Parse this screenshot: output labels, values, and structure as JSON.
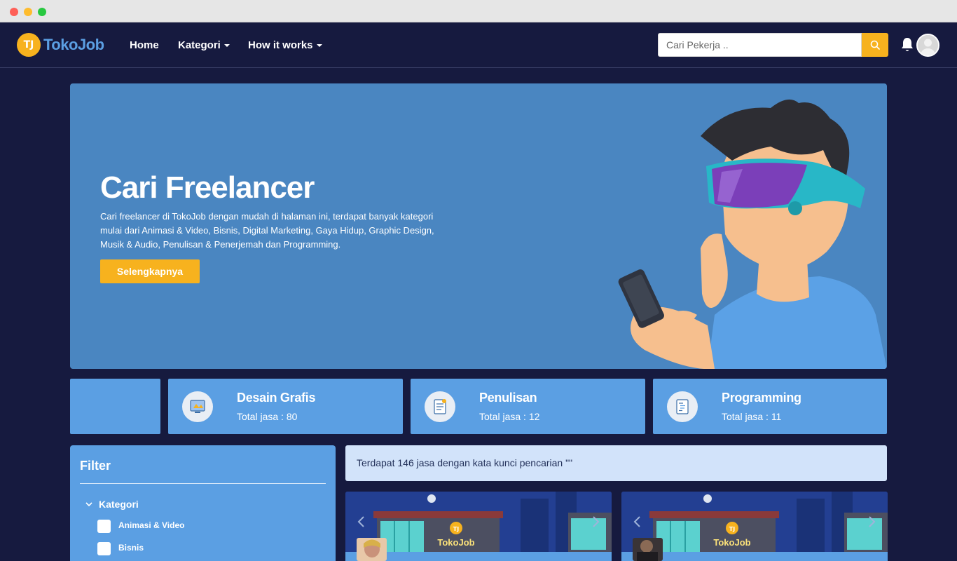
{
  "nav": {
    "brand": "TokoJob",
    "logo_mark": "TJ",
    "links": [
      {
        "label": "Home"
      },
      {
        "label": "Kategori"
      },
      {
        "label": "How it works"
      }
    ],
    "search_placeholder": "Cari Pekerja ..",
    "icons": [
      "search-icon",
      "bell-icon",
      "user-avatar"
    ]
  },
  "hero": {
    "title": "Cari Freelancer",
    "description": "Cari freelancer di TokoJob dengan mudah di halaman ini, terdapat banyak kategori mulai dari Animasi & Video, Bisnis, Digital Marketing, Gaya Hidup, Graphic Design, Musik & Audio, Penulisan & Penerjemah dan Programming.",
    "button": "Selengkapnya"
  },
  "categories": [
    {
      "name": "Desain Grafis",
      "total": "Total jasa : 80",
      "icon": "design-icon"
    },
    {
      "name": "Penulisan",
      "total": "Total jasa : 12",
      "icon": "writing-icon"
    },
    {
      "name": "Programming",
      "total": "Total jasa : 11",
      "icon": "code-icon"
    }
  ],
  "filter": {
    "title": "Filter",
    "section": "Kategori",
    "options": [
      "Animasi & Video",
      "Bisnis"
    ]
  },
  "results": {
    "info": "Terdapat 146 jasa dengan kata kunci pencarian \"\""
  },
  "services": [
    {
      "brand": "TokoJob",
      "logo_mark": "TJ"
    },
    {
      "brand": "TokoJob",
      "logo_mark": "TJ"
    }
  ],
  "colors": {
    "background": "#161a3f",
    "accent": "#f7b21e",
    "card": "#5b9fe3",
    "hero": "#4a86c1",
    "info": "#d2e3fa"
  }
}
